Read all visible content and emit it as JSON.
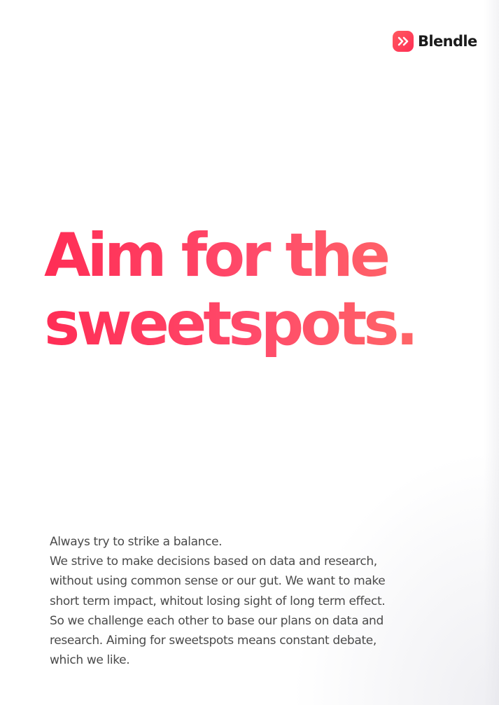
{
  "brand": {
    "name": "Blendle",
    "color": "#ff3b5c"
  },
  "headline": {
    "lines": [
      "Aim for the",
      "sweetspots."
    ]
  },
  "body": {
    "lines": [
      "Always try to strike a balance.",
      "We strive to make decisions based on data and research,",
      "without using common sense or our gut. We want to make",
      "short term impact, whitout losing sight of long term effect.",
      "So we challenge each other to base our plans on data and",
      "research. Aiming for sweetspots means constant debate,",
      "which we like."
    ]
  },
  "icons": {
    "logo": "double-chevron-right-icon"
  }
}
